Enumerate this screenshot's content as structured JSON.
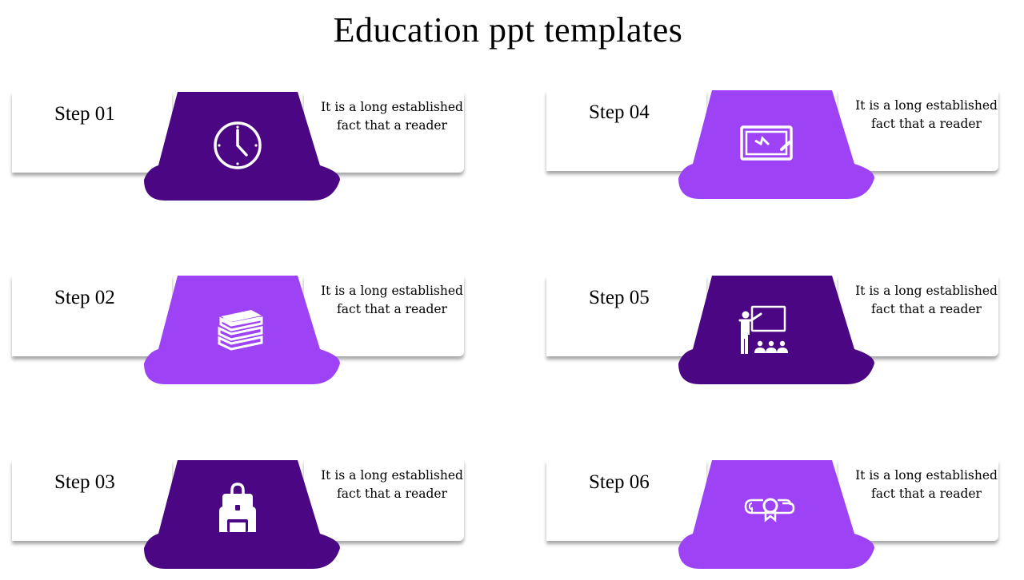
{
  "title": "Education ppt templates",
  "colors": {
    "dark": "#4a0683",
    "light": "#9d42f5"
  },
  "steps": [
    {
      "label": "Step 01",
      "text_line1": "It is a long established",
      "text_line2": "fact that a reader",
      "icon": "clock-icon",
      "shade": "dark"
    },
    {
      "label": "Step 02",
      "text_line1": "It is a long established",
      "text_line2": "fact that a reader",
      "icon": "books-icon",
      "shade": "light"
    },
    {
      "label": "Step 03",
      "text_line1": "It is a long established",
      "text_line2": "fact that a reader",
      "icon": "backpack-icon",
      "shade": "dark"
    },
    {
      "label": "Step 04",
      "text_line1": "It is a long established",
      "text_line2": "fact that a reader",
      "icon": "drawing-tablet-icon",
      "shade": "light"
    },
    {
      "label": "Step 05",
      "text_line1": "It is a long established",
      "text_line2": "fact that a reader",
      "icon": "teacher-classroom-icon",
      "shade": "dark"
    },
    {
      "label": "Step 06",
      "text_line1": "It is a long established",
      "text_line2": "fact that a reader",
      "icon": "diploma-icon",
      "shade": "light"
    }
  ]
}
